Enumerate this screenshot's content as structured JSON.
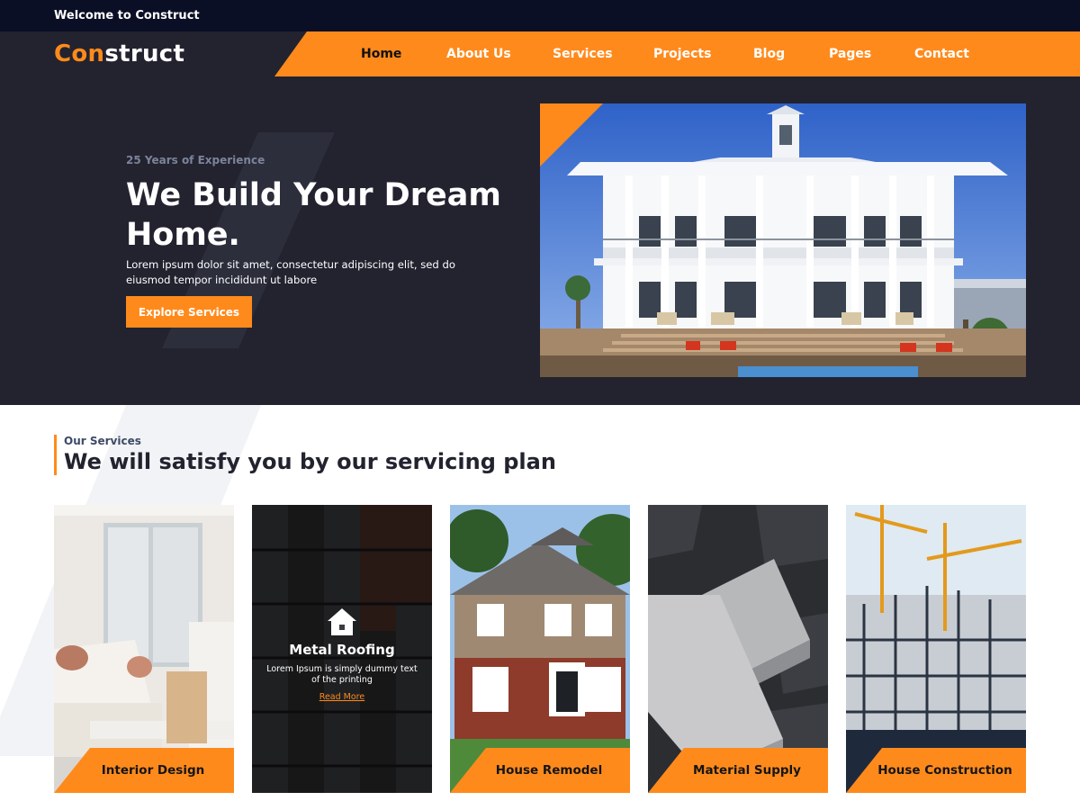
{
  "topbar": {
    "welcome": "Welcome to Construct"
  },
  "brand": {
    "logo_accent": "Con",
    "logo_rest": "struct"
  },
  "nav": {
    "items": [
      "Home",
      "About Us",
      "Services",
      "Projects",
      "Blog",
      "Pages",
      "Contact"
    ],
    "active": "Home"
  },
  "hero": {
    "subtitle": "25 Years of Experience",
    "title": "We Build Your Dream Home.",
    "description": "Lorem ipsum dolor sit amet, consectetur adipiscing elit, sed do eiusmod tempor incididunt ut labore",
    "button": "Explore Services",
    "image_alt": "large white two-story house with porch"
  },
  "services": {
    "label": "Our Services",
    "title": "We will satisfy you by our servicing plan",
    "cards": [
      {
        "label": "Interior Design"
      },
      {
        "label": "Metal Roofing",
        "description": "Lorem Ipsum is simply dummy text of the printing",
        "link": "Read More",
        "icon": "house-icon"
      },
      {
        "label": "House Remodel"
      },
      {
        "label": "Material Supply"
      },
      {
        "label": "House Construction"
      }
    ]
  },
  "colors": {
    "accent": "#ff8a1c",
    "dark": "#22232f",
    "topbar": "#0a0f26"
  }
}
